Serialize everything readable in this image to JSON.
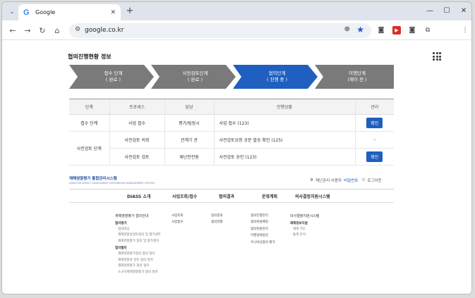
{
  "browser": {
    "tab": {
      "title": "Google",
      "logo": "G"
    },
    "new_tab": "+",
    "tab_menu": "⌄",
    "url": "google.co.kr",
    "window_controls": {
      "minimize": "—",
      "maximize": "☐",
      "close": "✕"
    }
  },
  "page": {
    "section_title": "협의진행현황 정보",
    "steps": [
      {
        "title": "접수 단계",
        "status": "( 완료 )",
        "color": "#7a7a7a"
      },
      {
        "title": "사전검토단계",
        "status": "( 완료 )",
        "color": "#7a7a7a"
      },
      {
        "title": "협의단계",
        "status": "( 진행 중 )",
        "color": "#1f5fbf"
      },
      {
        "title": "이행단계",
        "status": "(재이 전 )",
        "color": "#7a7a7a"
      }
    ],
    "table": {
      "headers": [
        "단계",
        "프로세스",
        "담당",
        "진행상황",
        "관리"
      ],
      "rows": [
        {
          "stage": "접수 단계",
          "process": "사업 접수",
          "owner": "평가/팀장시",
          "progress": "사업 접수 (123)",
          "action": "확인"
        },
        {
          "stage": "사전검토 단계",
          "process": "사전검토 의뢰",
          "owner": "관계기 관",
          "progress": "사전검토요청 공문 발송 확인 (125)",
          "action": "–"
        },
        {
          "stage": "",
          "process": "사전검토 검토",
          "owner": "재난안전원",
          "progress": "사전검토 승인 (123)",
          "action": "확인"
        }
      ]
    },
    "footer": {
      "logo": "재해영향평가 통합관리시스템",
      "logo_sub": "DISASTER IMPACT ASSESSMENT INTEGRATED MANAGEMENT SYSTEM",
      "user_link_prefix": "재난관리 사용자",
      "user_link": "비밀번호",
      "logout": "로그아웃",
      "nav": [
        "DIASS 소개",
        "사업조회/접수",
        "협의결과",
        "운영계획",
        "의사결정지원시스템"
      ],
      "sitemap": [
        {
          "head": "재해영향평가 협의안내",
          "groups": [
            {
              "label": "협의평가",
              "items": [
                "협의대상",
                "재해영향성검토협의 및 평가세부",
                "재해영향평가 협의 및 평가절차"
              ]
            },
            {
              "label": "협의절차",
              "items": [
                "재해영향평가협의 협의 절차",
                "재해영향성 검토 협의 절차",
                "재해영향평가 협의 절차",
                "소규모재해영향평가 협의 절차"
              ]
            }
          ]
        },
        {
          "head": "",
          "groups": [
            {
              "label": "",
              "items": [
                "사업조회",
                "사업접수"
              ]
            }
          ]
        },
        {
          "head": "",
          "groups": [
            {
              "label": "",
              "items": [
                "협의결과",
                "협의현황"
              ]
            }
          ]
        },
        {
          "head": "",
          "groups": [
            {
              "label": "",
              "items": [
                "협의진행관리",
                "협의위원배정",
                "협의위원관리",
                "이행실태점검",
                "우니비상협의 평가"
              ]
            }
          ]
        },
        {
          "head": "의사결정지원시스템",
          "groups": [
            {
              "label": "재해정보지원",
              "items": [
                "재해 지도",
                "통계 분석"
              ]
            }
          ]
        }
      ]
    }
  }
}
